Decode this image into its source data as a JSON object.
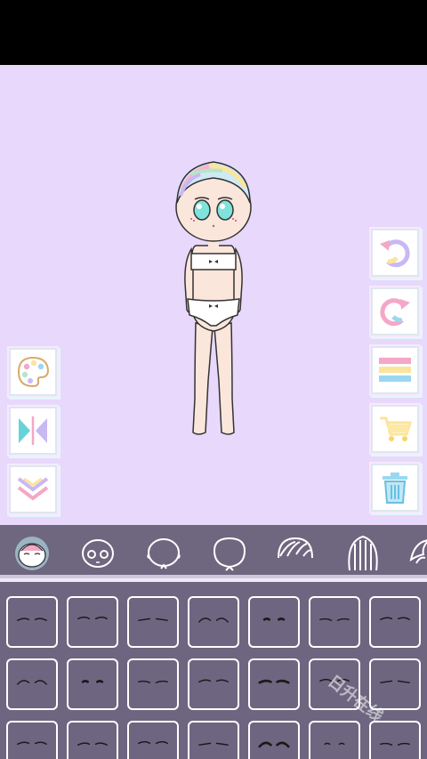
{
  "app": {
    "watermark": "日升在线"
  },
  "colors": {
    "background": "#e8d8fb",
    "tabbar": "#6f6680",
    "grid": "#6e6680",
    "accent_pink": "#f4a7c6",
    "accent_teal": "#67d3d8"
  },
  "left_tools": [
    {
      "name": "palette-button",
      "icon": "palette-icon"
    },
    {
      "name": "flip-button",
      "icon": "flip-horizontal-icon"
    },
    {
      "name": "layer-down-button",
      "icon": "chevron-double-down-icon"
    }
  ],
  "right_tools": [
    {
      "name": "undo-button",
      "icon": "undo-icon"
    },
    {
      "name": "redo-button",
      "icon": "redo-icon"
    },
    {
      "name": "menu-button",
      "icon": "menu-stripes-icon"
    },
    {
      "name": "shop-button",
      "icon": "cart-icon"
    },
    {
      "name": "delete-button",
      "icon": "trash-icon"
    }
  ],
  "category_tabs": [
    {
      "name": "tab-face-expression",
      "icon": "face-eyebrows-icon",
      "selected": true
    },
    {
      "name": "tab-face-eyes",
      "icon": "face-eyes-icon",
      "selected": false
    },
    {
      "name": "tab-face-base",
      "icon": "face-outline-icon",
      "selected": false
    },
    {
      "name": "tab-face-shape",
      "icon": "face-shape-icon",
      "selected": false
    },
    {
      "name": "tab-hair-front",
      "icon": "hair-front-icon",
      "selected": false
    },
    {
      "name": "tab-hair-back",
      "icon": "hair-back-icon",
      "selected": false
    },
    {
      "name": "tab-hair-side",
      "icon": "hair-side-icon",
      "selected": false
    }
  ],
  "item_grid": {
    "item_icon": "eyebrow-option-icon",
    "rows": 3,
    "columns": 7
  }
}
